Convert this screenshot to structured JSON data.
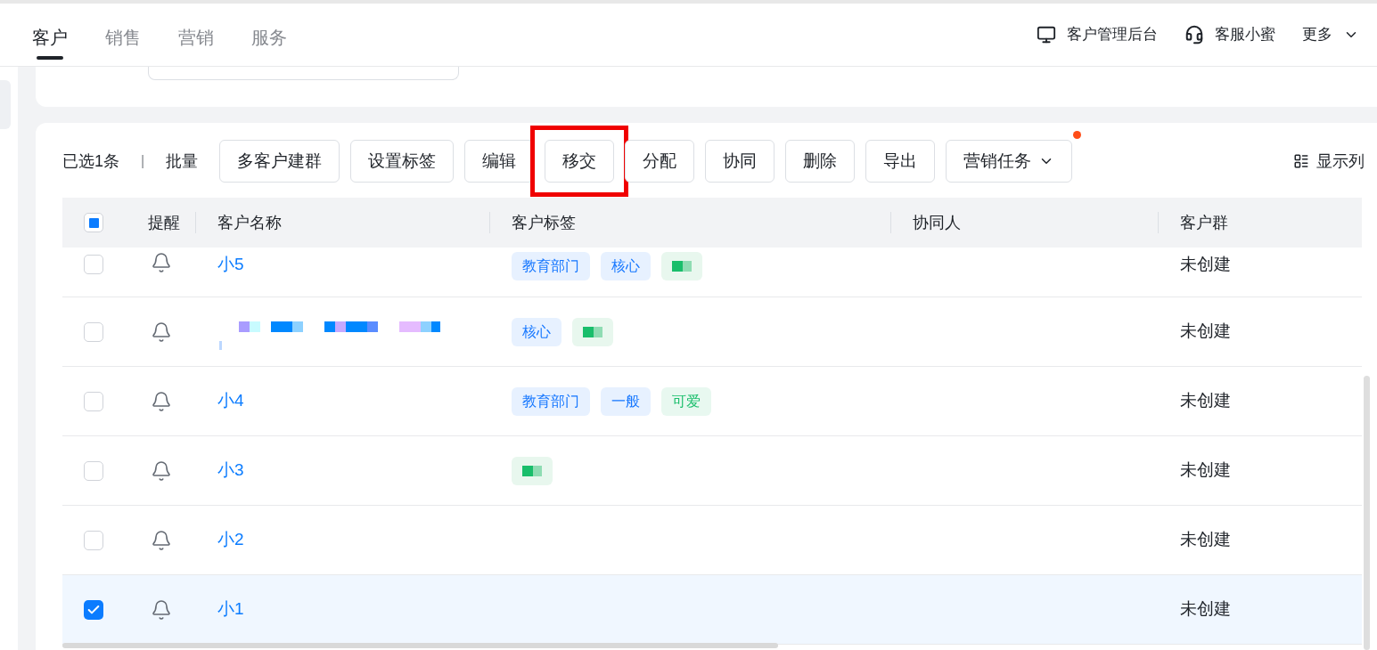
{
  "nav": {
    "tabs": [
      {
        "label": "客户",
        "selected": true
      },
      {
        "label": "销售",
        "selected": false
      },
      {
        "label": "营销",
        "selected": false
      },
      {
        "label": "服务",
        "selected": false
      }
    ],
    "links": [
      {
        "kind": "monitor",
        "label": "客户管理后台"
      },
      {
        "kind": "headset",
        "label": "客服小蜜"
      },
      {
        "kind": "dropdown",
        "label": "更多"
      }
    ]
  },
  "toolbar": {
    "selection": "已选1条",
    "separator": "|",
    "batch": "批量",
    "buttons": [
      {
        "label": "多客户建群"
      },
      {
        "label": "设置标签"
      },
      {
        "label": "编辑"
      },
      {
        "label": "移交",
        "highlighted": true
      },
      {
        "label": "分配"
      },
      {
        "label": "协同"
      },
      {
        "label": "删除"
      },
      {
        "label": "导出"
      },
      {
        "label": "营销任务",
        "dropdown": true,
        "badge": true
      }
    ],
    "columns_button": "显示列"
  },
  "table": {
    "select_all_indeterminate": true,
    "columns": [
      "提醒",
      "客户名称",
      "客户标签",
      "协同人",
      "客户群"
    ],
    "rows": [
      {
        "checked": false,
        "name": {
          "kind": "text",
          "text": "小5"
        },
        "tags": [
          {
            "kind": "text",
            "label": "教育部门",
            "color": "#1677ff"
          },
          {
            "kind": "text",
            "label": "核心",
            "color": "#1677ff"
          },
          {
            "kind": "mosaic"
          }
        ],
        "group": "未创建"
      },
      {
        "checked": false,
        "name": {
          "kind": "mosaic"
        },
        "tags": [
          {
            "kind": "text",
            "label": "核心",
            "color": "#1677ff"
          },
          {
            "kind": "mosaic"
          }
        ],
        "group": "未创建"
      },
      {
        "checked": false,
        "name": {
          "kind": "text",
          "text": "小4"
        },
        "tags": [
          {
            "kind": "text",
            "label": "教育部门",
            "color": "#1677ff"
          },
          {
            "kind": "text",
            "label": "一般",
            "color": "#1677ff"
          },
          {
            "kind": "text",
            "label": "可爱",
            "color": "#19be6b"
          }
        ],
        "group": "未创建"
      },
      {
        "checked": false,
        "name": {
          "kind": "text",
          "text": "小3"
        },
        "tags": [
          {
            "kind": "mosaic"
          }
        ],
        "group": "未创建"
      },
      {
        "checked": false,
        "name": {
          "kind": "text",
          "text": "小2"
        },
        "tags": [],
        "group": "未创建"
      },
      {
        "checked": true,
        "name": {
          "kind": "text",
          "text": "小1"
        },
        "tags": [],
        "group": "未创建"
      }
    ]
  }
}
